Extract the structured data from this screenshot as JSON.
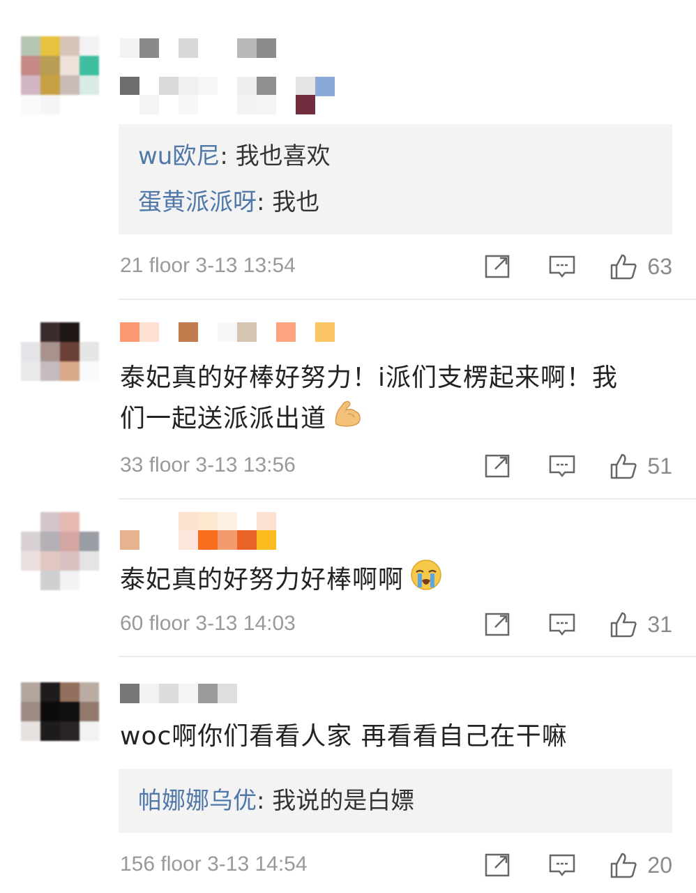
{
  "comments": [
    {
      "replies": [
        {
          "user": "wu欧尼",
          "text": ": 我也喜欢"
        },
        {
          "user": "蛋黄派派呀",
          "text": ": 我也"
        }
      ],
      "meta": "21 floor 3-13 13:54",
      "likes": "63"
    },
    {
      "text_line1": "泰妃真的好棒好努力！i派们支楞起来啊！我",
      "text_line2": "们一起送派派出道",
      "emoji": "flexed-biceps-emoji",
      "meta": "33 floor 3-13 13:56",
      "likes": "51"
    },
    {
      "text_line1": "泰妃真的好努力好棒啊啊",
      "emoji": "crying-face-emoji",
      "meta": "60 floor 3-13 14:03",
      "likes": "31"
    },
    {
      "text_line1": "woc啊你们看看人家 再看看自己在干嘛",
      "replies": [
        {
          "user": "帕娜娜乌优",
          "text": ": 我说的是白嫖"
        }
      ],
      "meta": "156 floor 3-13 14:54",
      "likes": "20"
    }
  ],
  "colors": {
    "reply_user": "#4f78a8",
    "meta": "#999999",
    "reply_bg": "#f3f3f3"
  }
}
